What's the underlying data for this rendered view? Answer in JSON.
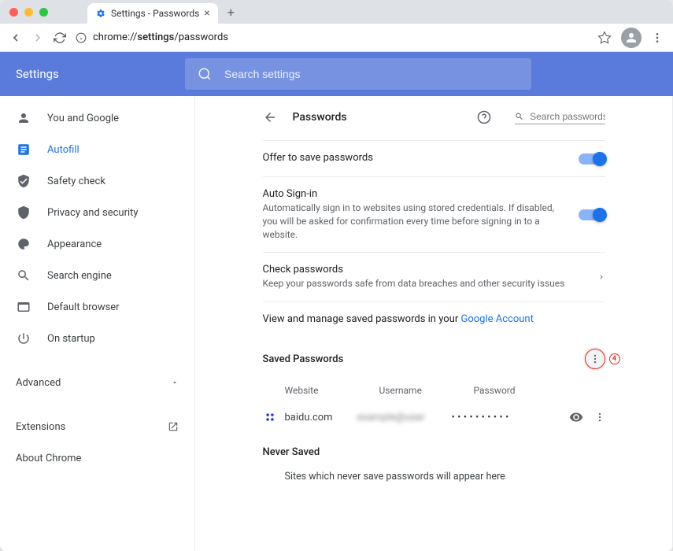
{
  "browser": {
    "tab_title": "Settings - Passwords",
    "url_protocol": "chrome://",
    "url_host": "settings",
    "url_path": "/passwords"
  },
  "header": {
    "title": "Settings",
    "search_placeholder": "Search settings"
  },
  "sidebar": {
    "items": [
      {
        "label": "You and Google"
      },
      {
        "label": "Autofill"
      },
      {
        "label": "Safety check"
      },
      {
        "label": "Privacy and security"
      },
      {
        "label": "Appearance"
      },
      {
        "label": "Search engine"
      },
      {
        "label": "Default browser"
      },
      {
        "label": "On startup"
      }
    ],
    "advanced": "Advanced",
    "extensions": "Extensions",
    "about": "About Chrome"
  },
  "page": {
    "title": "Passwords",
    "search_placeholder": "Search passwords",
    "offer_save": "Offer to save passwords",
    "auto_signin_title": "Auto Sign-in",
    "auto_signin_desc": "Automatically sign in to websites using stored credentials. If disabled, you will be asked for confirmation every time before signing in to a website.",
    "check_pw_title": "Check passwords",
    "check_pw_desc": "Keep your passwords safe from data breaches and other security issues",
    "view_manage_pre": "View and manage saved passwords in your ",
    "view_manage_link": "Google Account",
    "saved_heading": "Saved Passwords",
    "col_website": "Website",
    "col_username": "Username",
    "col_password": "Password",
    "rows": [
      {
        "site": "baidu.com",
        "username_blur": "example@user",
        "password_masked": "• • • • • • • • • •"
      }
    ],
    "never_heading": "Never Saved",
    "never_desc": "Sites which never save passwords will appear here",
    "annotation_num": "4"
  }
}
